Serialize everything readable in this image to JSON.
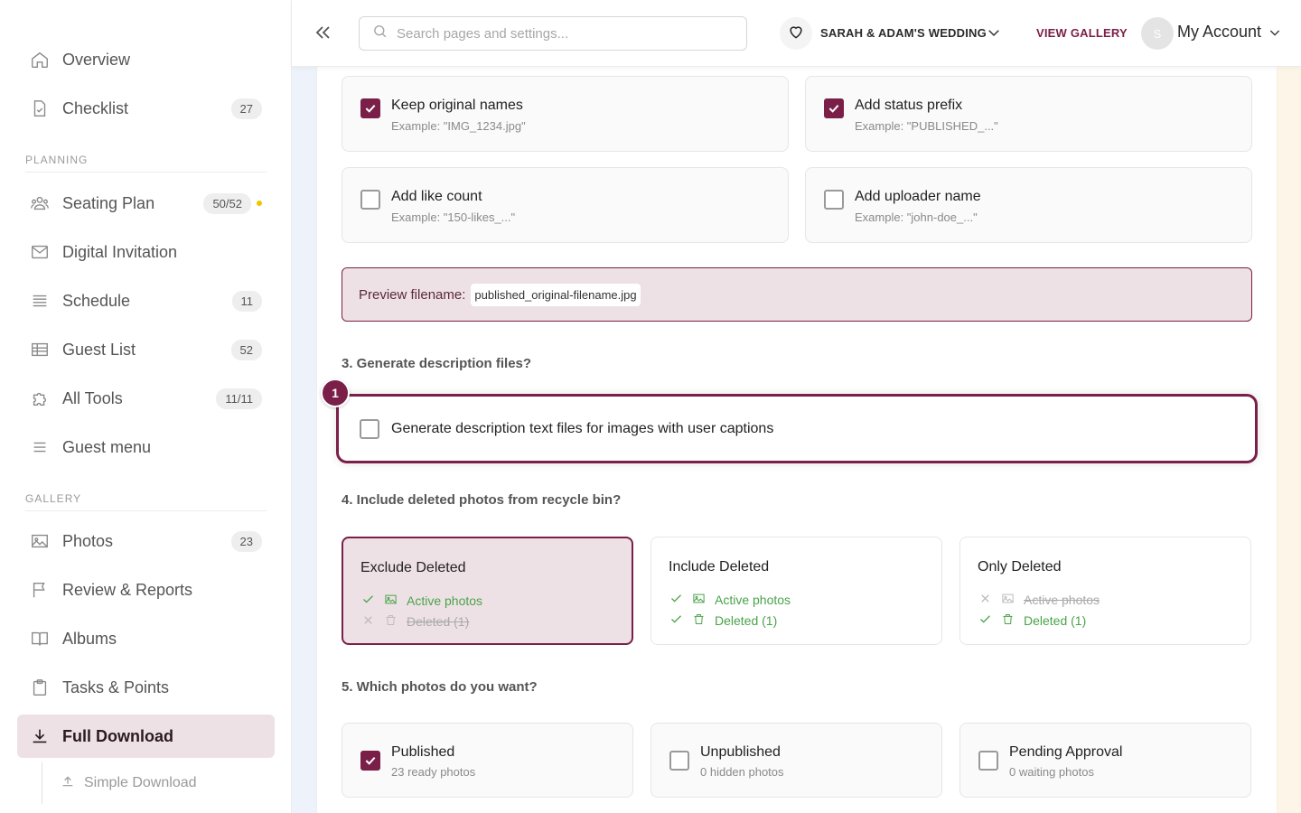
{
  "sidebar": {
    "items": [
      {
        "label": "Overview",
        "icon": "home-icon"
      },
      {
        "label": "Checklist",
        "icon": "document-icon",
        "badge": "27"
      },
      {
        "label": "Seating Plan",
        "icon": "people-icon",
        "badge": "50/52",
        "dot": true
      },
      {
        "label": "Digital Invitation",
        "icon": "mail-icon"
      },
      {
        "label": "Schedule",
        "icon": "list-icon",
        "badge": "11"
      },
      {
        "label": "Guest List",
        "icon": "table-icon",
        "badge": "52"
      },
      {
        "label": "All Tools",
        "icon": "puzzle-icon",
        "badge": "11/11"
      },
      {
        "label": "Guest menu",
        "icon": "menu-icon"
      },
      {
        "label": "Photos",
        "icon": "image-icon",
        "badge": "23"
      },
      {
        "label": "Review & Reports",
        "icon": "flag-icon"
      },
      {
        "label": "Albums",
        "icon": "book-icon"
      },
      {
        "label": "Tasks & Points",
        "icon": "clipboard-icon"
      },
      {
        "label": "Full Download",
        "icon": "download-icon",
        "active": true
      }
    ],
    "sections": {
      "planning": "PLANNING",
      "gallery": "GALLERY"
    },
    "sub_item": "Simple Download"
  },
  "header": {
    "search_placeholder": "Search pages and settings...",
    "event_name": "SARAH & ADAM'S WEDDING",
    "view_gallery": "VIEW GALLERY",
    "avatar_initial": "S",
    "account_label": "My Account"
  },
  "filename_options": [
    {
      "title": "Keep original names",
      "example": "Example: \"IMG_1234.jpg\"",
      "checked": true
    },
    {
      "title": "Add status prefix",
      "example": "Example: \"PUBLISHED_...\"",
      "checked": true
    },
    {
      "title": "Add like count",
      "example": "Example: \"150-likes_...\"",
      "checked": false
    },
    {
      "title": "Add uploader name",
      "example": "Example: \"john-doe_...\"",
      "checked": false
    }
  ],
  "preview": {
    "label": "Preview filename:",
    "value": "published_original-filename.jpg"
  },
  "q3": {
    "title": "3. Generate description files?",
    "step": "1",
    "option": "Generate description text files for images with user captions",
    "checked": false
  },
  "q4": {
    "title": "4. Include deleted photos from recycle bin?",
    "choices": [
      {
        "title": "Exclude Deleted",
        "selected": true,
        "active_label": "Active photos",
        "active_on": true,
        "deleted_label": "Deleted (1)",
        "deleted_on": false
      },
      {
        "title": "Include Deleted",
        "selected": false,
        "active_label": "Active photos",
        "active_on": true,
        "deleted_label": "Deleted (1)",
        "deleted_on": true
      },
      {
        "title": "Only Deleted",
        "selected": false,
        "active_label": "Active photos",
        "active_on": false,
        "deleted_label": "Deleted (1)",
        "deleted_on": true
      }
    ]
  },
  "q5": {
    "title": "5. Which photos do you want?",
    "options": [
      {
        "title": "Published",
        "sub": "23 ready photos",
        "checked": true
      },
      {
        "title": "Unpublished",
        "sub": "0 hidden photos",
        "checked": false
      },
      {
        "title": "Pending Approval",
        "sub": "0 waiting photos",
        "checked": false
      }
    ]
  },
  "colors": {
    "accent": "#7a1f47",
    "accent_light": "#eee1e6",
    "ok": "#4aa34a"
  }
}
